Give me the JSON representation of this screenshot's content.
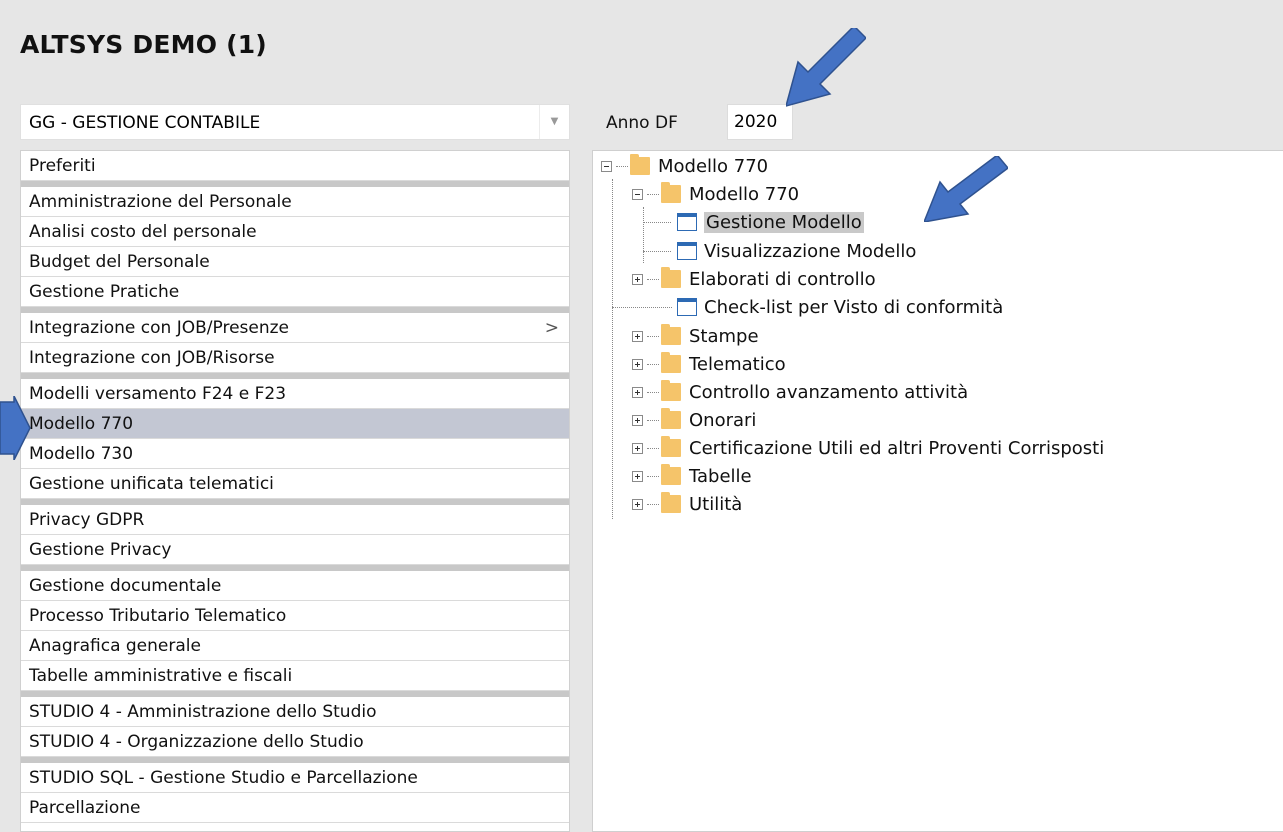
{
  "app": {
    "title": "ALTSYS DEMO (1)"
  },
  "module_select": {
    "value": "GG - GESTIONE CONTABILE",
    "caret_icon": "chevron-down-icon"
  },
  "anno": {
    "label": "Anno DF",
    "value": "2020"
  },
  "menu": {
    "items": [
      {
        "label": "Preferiti"
      },
      {
        "label": "Amministrazione del Personale"
      },
      {
        "label": "Analisi costo del personale"
      },
      {
        "label": "Budget del Personale"
      },
      {
        "label": "Gestione Pratiche"
      },
      {
        "label": "Integrazione con JOB/Presenze",
        "chevron": ">"
      },
      {
        "label": "Integrazione con JOB/Risorse"
      },
      {
        "label": "Modelli versamento F24 e F23"
      },
      {
        "label": "Modello 770"
      },
      {
        "label": "Modello 730"
      },
      {
        "label": "Gestione unificata telematici"
      },
      {
        "label": "Privacy GDPR"
      },
      {
        "label": "Gestione Privacy"
      },
      {
        "label": "Gestione documentale"
      },
      {
        "label": "Processo Tributario Telematico"
      },
      {
        "label": "Anagrafica generale"
      },
      {
        "label": "Tabelle amministrative e fiscali"
      },
      {
        "label": "STUDIO 4 - Amministrazione dello Studio"
      },
      {
        "label": "STUDIO 4 - Organizzazione dello Studio"
      },
      {
        "label": "STUDIO SQL - Gestione Studio e Parcellazione"
      },
      {
        "label": "Parcellazione"
      }
    ]
  },
  "tree": {
    "nodes": [
      {
        "label": "Modello 770"
      },
      {
        "label": "Modello 770"
      },
      {
        "label": "Gestione Modello"
      },
      {
        "label": "Visualizzazione Modello"
      },
      {
        "label": "Elaborati di controllo"
      },
      {
        "label": "Check-list per Visto di conformità"
      },
      {
        "label": "Stampe"
      },
      {
        "label": "Telematico"
      },
      {
        "label": "Controllo avanzamento attività"
      },
      {
        "label": "Onorari"
      },
      {
        "label": "Certificazione Utili ed altri Proventi Corrisposti"
      },
      {
        "label": "Tabelle"
      },
      {
        "label": "Utilità"
      }
    ]
  },
  "colors": {
    "arrow": "#4472c4",
    "folder": "#f5c46a",
    "selected_row": "#c3c7d3"
  }
}
